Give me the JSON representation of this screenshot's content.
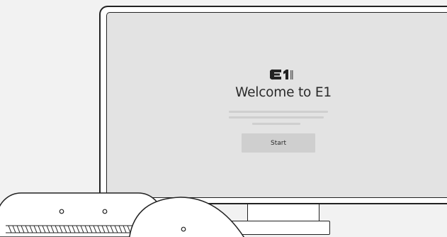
{
  "welcome_screen": {
    "logo_text": "E1",
    "title": "Welcome to E1",
    "start_button_label": "Start"
  },
  "colors": {
    "background": "#f2f2f2",
    "screen": "#e3e3e3",
    "placeholder_lines": "#cfcfcf",
    "outline": "#222222"
  },
  "icons": [
    "e1-logo-icon",
    "indicator-dot-icon",
    "speaker-grille-icon"
  ]
}
